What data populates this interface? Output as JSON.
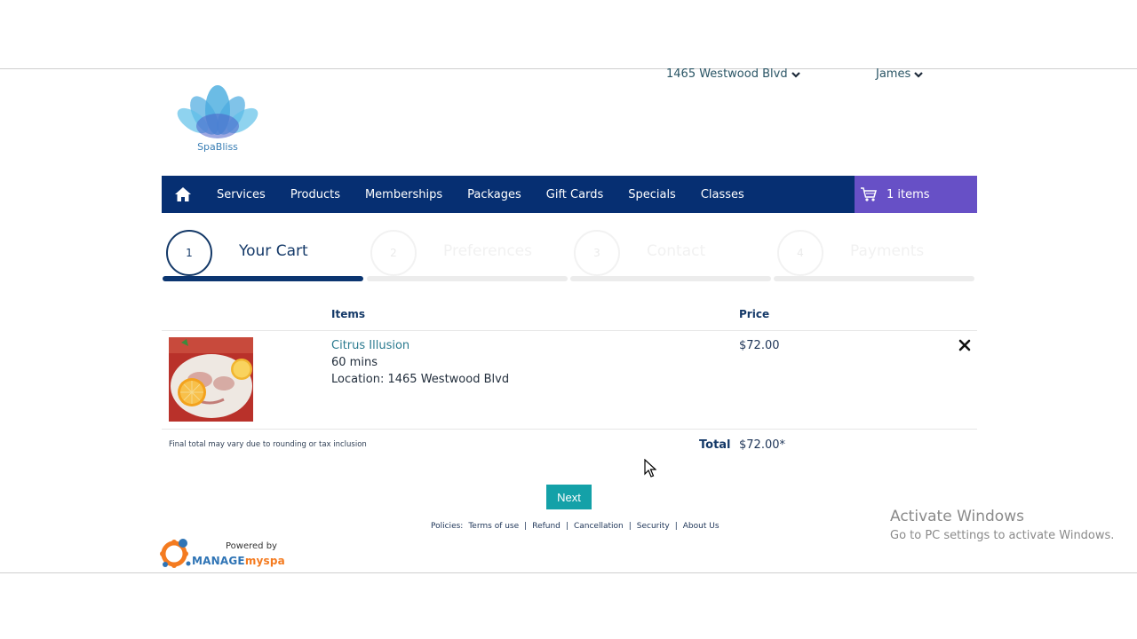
{
  "header": {
    "location_label": "1465 Westwood Blvd",
    "user_label": "James"
  },
  "logo": {
    "text": "SpaBliss"
  },
  "nav": {
    "items": [
      "Services",
      "Products",
      "Memberships",
      "Packages",
      "Gift Cards",
      "Specials",
      "Classes"
    ],
    "cart_label": "1 items"
  },
  "steps": [
    {
      "number": "1",
      "label": "Your Cart"
    },
    {
      "number": "2",
      "label": "Preferences"
    },
    {
      "number": "3",
      "label": "Contact"
    },
    {
      "number": "4",
      "label": "Payments"
    }
  ],
  "table": {
    "col_items": "Items",
    "col_price": "Price",
    "rows": [
      {
        "name": "Citrus Illusion",
        "duration": "60 mins",
        "location": "Location: 1465 Westwood Blvd",
        "price": "$72.00"
      }
    ]
  },
  "totals": {
    "disclaimer": "Final total may vary due to rounding or tax inclusion",
    "label": "Total",
    "value": "$72.00*"
  },
  "actions": {
    "next_label": "Next"
  },
  "footer": {
    "policies_label": "Policies:",
    "links": [
      "Terms of use",
      "Refund",
      "Cancellation",
      "Security",
      "About Us"
    ],
    "powered_by": "Powered by",
    "brand_part1": "MANAGE",
    "brand_part2": "myspa"
  },
  "os_overlay": {
    "title": "Activate Windows",
    "subtitle": "Go to PC settings to activate Windows."
  },
  "colors": {
    "nav_bg": "#062f72",
    "cart_bg": "#6750c6",
    "accent_teal": "#14a1a8",
    "step_active": "#0b3570"
  }
}
